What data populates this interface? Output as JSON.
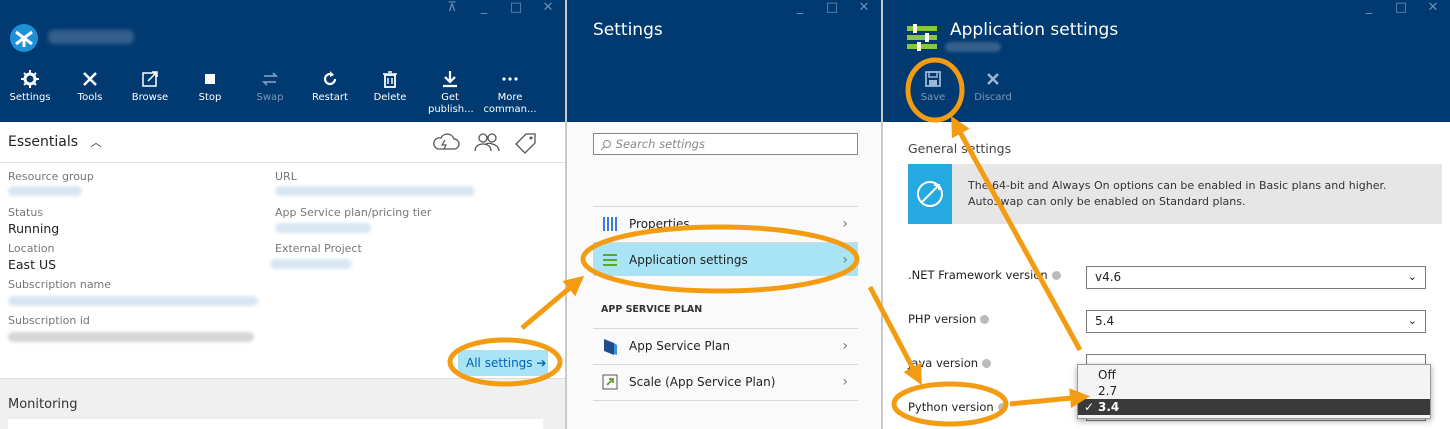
{
  "blade1": {
    "commands": [
      {
        "label": "Settings",
        "icon": "gear-icon"
      },
      {
        "label": "Tools",
        "icon": "tools-icon"
      },
      {
        "label": "Browse",
        "icon": "browse-icon"
      },
      {
        "label": "Stop",
        "icon": "stop-icon"
      },
      {
        "label": "Swap",
        "icon": "swap-icon"
      },
      {
        "label": "Restart",
        "icon": "restart-icon"
      },
      {
        "label": "Delete",
        "icon": "delete-icon"
      },
      {
        "label": "Get publish...",
        "icon": "download-icon"
      },
      {
        "label": "More comman...",
        "icon": "more-icon"
      }
    ],
    "essentials_title": "Essentials",
    "fields": {
      "resource_group_label": "Resource group",
      "status_label": "Status",
      "status_value": "Running",
      "location_label": "Location",
      "location_value": "East US",
      "subscription_name_label": "Subscription name",
      "subscription_id_label": "Subscription id",
      "url_label": "URL",
      "plan_label": "App Service plan/pricing tier",
      "external_label": "External Project"
    },
    "all_settings_label": "All settings",
    "all_settings_arrow": "➔",
    "monitoring_title": "Monitoring"
  },
  "blade2": {
    "title": "Settings",
    "search_placeholder": "Search settings",
    "items": [
      {
        "label": "Properties"
      },
      {
        "label": "Application settings"
      }
    ],
    "section_title": "APP SERVICE PLAN",
    "plan_items": [
      {
        "label": "App Service Plan"
      },
      {
        "label": "Scale (App Service Plan)"
      }
    ],
    "chevron": "›"
  },
  "blade3": {
    "title": "Application settings",
    "save_label": "Save",
    "discard_label": "Discard",
    "general_title": "General settings",
    "info_text": "The 64-bit and Always On options can be enabled in Basic plans and higher. AutoSwap can only be enabled on Standard plans.",
    "net_label": ".NET Framework version",
    "net_value": "v4.6",
    "php_label": "PHP version",
    "php_value": "5.4",
    "java_label": "Java version",
    "python_label": "Python version",
    "python_options": [
      "Off",
      "2.7",
      "3.4"
    ],
    "python_selected": "3.4",
    "check": "✓",
    "select_arrow": "⌄"
  },
  "window_buttons": [
    "⊼",
    "_",
    "□",
    "✕"
  ],
  "colors": {
    "header": "#003a70",
    "highlight": "#f39c12",
    "selected": "#a8e4f5"
  }
}
